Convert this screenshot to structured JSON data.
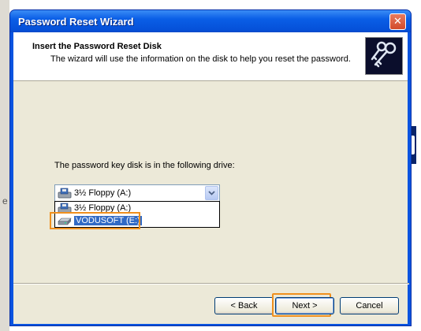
{
  "window": {
    "title": "Password Reset Wizard"
  },
  "backdrop": {
    "left_letter": "e"
  },
  "header": {
    "title": "Insert the Password Reset Disk",
    "subtitle": "The wizard will use the information on the disk to help you reset the password.",
    "icon": "keys-icon"
  },
  "body": {
    "instruction": "The password key disk is in the following drive:"
  },
  "drive_combo": {
    "selected": "3½ Floppy (A:)",
    "options": [
      {
        "label": "3½ Floppy (A:)",
        "icon": "floppy-drive-icon",
        "highlighted": false
      },
      {
        "label": "VODUSOFT (E:)",
        "icon": "removable-drive-icon",
        "highlighted": true
      }
    ]
  },
  "buttons": {
    "back": "< Back",
    "next": "Next >",
    "cancel": "Cancel"
  },
  "colors": {
    "titlebar": "#0a5ee6",
    "client_bg": "#ece9d8",
    "selection": "#316ac5",
    "callout": "#f0901e"
  }
}
